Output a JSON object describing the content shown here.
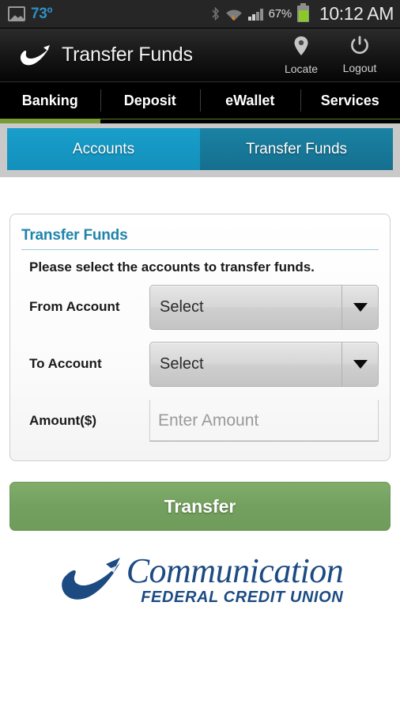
{
  "status_bar": {
    "gallery_icon": "gallery-icon",
    "temperature": "73º",
    "bluetooth_icon": "bluetooth-icon",
    "wifi_icon": "wifi-icon",
    "signal_icon": "signal-bars-icon",
    "battery_percent": "67%",
    "battery_icon": "battery-icon",
    "clock": "10:12 AM"
  },
  "app_bar": {
    "logo_icon": "swoosh-logo-icon",
    "title": "Transfer Funds",
    "actions": [
      {
        "label": "Locate",
        "icon": "map-pin-icon"
      },
      {
        "label": "Logout",
        "icon": "power-icon"
      }
    ]
  },
  "main_nav": {
    "items": [
      {
        "label": "Banking",
        "active": true
      },
      {
        "label": "Deposit",
        "active": false
      },
      {
        "label": "eWallet",
        "active": false
      },
      {
        "label": "Services",
        "active": false
      }
    ],
    "active_indicator_color": "#7a9a35"
  },
  "sub_tabs": {
    "items": [
      {
        "label": "Accounts",
        "selected": false,
        "color": "#1390bb"
      },
      {
        "label": "Transfer Funds",
        "selected": true,
        "color": "#156f8e"
      }
    ]
  },
  "card": {
    "title": "Transfer Funds",
    "instruction": "Please select the accounts to transfer funds.",
    "title_color": "#1f84ac",
    "fields": [
      {
        "label": "From Account",
        "type": "select",
        "value": "Select",
        "caret": "chevron-down-icon"
      },
      {
        "label": "To Account",
        "type": "select",
        "value": "Select",
        "caret": "chevron-down-icon"
      },
      {
        "label": "Amount($)",
        "type": "text",
        "value": "",
        "placeholder": "Enter Amount"
      }
    ]
  },
  "primary_button": {
    "label": "Transfer",
    "color": "#74a05f"
  },
  "footer_logo": {
    "mark_icon": "swoosh-logo-icon",
    "word": "Communication",
    "subtitle": "FEDERAL CREDIT UNION",
    "color": "#1c4b82"
  }
}
